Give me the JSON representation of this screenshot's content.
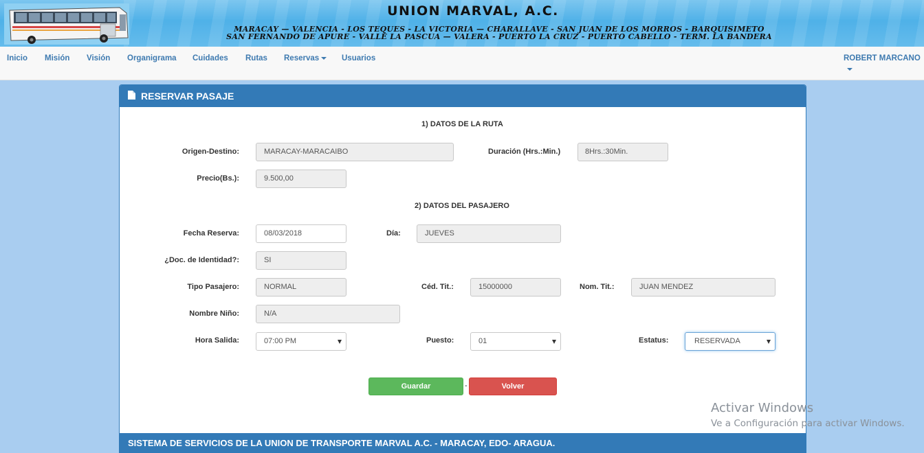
{
  "banner": {
    "title": "UNION MARVAL, A.C.",
    "routes_line1": "MARACAY — VALENCIA - LOS TEQUES - LA VICTORIA — CHARALLAVE - SAN JUAN DE LOS MORROS - BARQUISIMETO",
    "routes_line2": "SAN FERNANDO DE APURE - VALLE LA PASCUA — VALERA - PUERTO LA CRUZ - PUERTO CABELLO - TERM. LA BANDERA"
  },
  "nav": {
    "items": [
      "Inicio",
      "Misión",
      "Visión",
      "Organigrama",
      "Cuidades",
      "Rutas",
      "Reservas",
      "Usuarios"
    ],
    "user": "ROBERT MARCANO"
  },
  "panel": {
    "title": "RESERVAR PASAJE",
    "section1": "1) DATOS DE LA RUTA",
    "section2": "2) DATOS DEL PASAJERO",
    "route": {
      "origen_label": "Origen-Destino:",
      "origen_value": "MARACAY-MARACAIBO",
      "duracion_label": "Duración (Hrs.:Min.)",
      "duracion_value": "8Hrs.:30Min.",
      "precio_label": "Precio(Bs.):",
      "precio_value": "9.500,00"
    },
    "passenger": {
      "fecha_label": "Fecha Reserva:",
      "fecha_value": "08/03/2018",
      "dia_label": "Día:",
      "dia_value": "JUEVES",
      "doc_label": "¿Doc. de Identidad?:",
      "doc_value": "SI",
      "tipo_label": "Tipo Pasajero:",
      "tipo_value": "NORMAL",
      "ced_label": "Céd. Tit.:",
      "ced_value": "15000000",
      "nom_label": "Nom. Tit.:",
      "nom_value": "JUAN MENDEZ",
      "nino_label": "Nombre Niño:",
      "nino_value": "N/A",
      "hora_label": "Hora Salida:",
      "hora_value": "07:00 PM",
      "puesto_label": "Puesto:",
      "puesto_value": "01",
      "estatus_label": "Estatus:",
      "estatus_value": "RESERVADA"
    },
    "buttons": {
      "guardar": "Guardar",
      "separator": "-",
      "volver": "Volver"
    },
    "footer": "SISTEMA DE SERVICIOS DE LA UNION DE TRANSPORTE MARVAL A.C. - MARACAY, EDO- ARAGUA."
  },
  "watermark": {
    "line1": "Activar Windows",
    "line2": "Ve a Configuración para activar Windows."
  },
  "colors": {
    "page_bg": "#a9cdf0",
    "primary": "#337ab7",
    "success": "#5cb85c",
    "danger": "#d9534f",
    "nav_link": "#3e7ab0"
  }
}
